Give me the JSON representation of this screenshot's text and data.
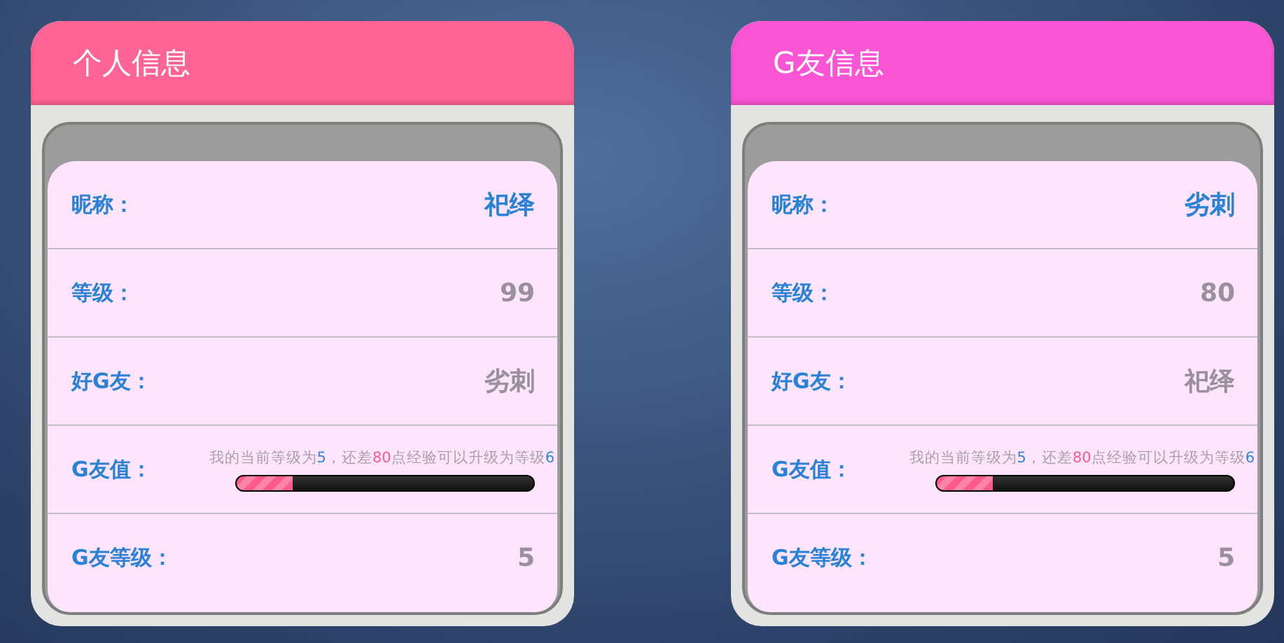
{
  "cards": [
    {
      "title": "个人信息",
      "color": "#fe6496",
      "rows": [
        {
          "kind": "highlight",
          "label": "昵称：",
          "value": "祀绎"
        },
        {
          "kind": "plain",
          "label": "等级：",
          "value": "99"
        },
        {
          "kind": "plain",
          "label": "好G友：",
          "value": "劣刺"
        },
        {
          "kind": "progress",
          "label": "G友值：",
          "hint": [
            {
              "kind": "plain",
              "text": "我的当前等级为"
            },
            {
              "kind": "number",
              "text": "5"
            },
            {
              "kind": "plain",
              "text": "，还差"
            },
            {
              "kind": "alert",
              "text": "80"
            },
            {
              "kind": "plain",
              "text": "点经验可以升级为等级"
            },
            {
              "kind": "number",
              "text": "6"
            }
          ],
          "level": 0.19
        },
        {
          "kind": "plain",
          "label": "G友等级：",
          "value": "5"
        }
      ]
    },
    {
      "title": "G友信息",
      "color": "#f955d5",
      "rows": [
        {
          "kind": "highlight",
          "label": "昵称：",
          "value": "劣刺"
        },
        {
          "kind": "plain",
          "label": "等级：",
          "value": "80"
        },
        {
          "kind": "plain",
          "label": "好G友：",
          "value": "祀绎"
        },
        {
          "kind": "progress",
          "label": "G友值：",
          "hint": [
            {
              "kind": "plain",
              "text": "我的当前等级为"
            },
            {
              "kind": "number",
              "text": "5"
            },
            {
              "kind": "plain",
              "text": "，还差"
            },
            {
              "kind": "alert",
              "text": "80"
            },
            {
              "kind": "plain",
              "text": "点经验可以升级为等级"
            },
            {
              "kind": "number",
              "text": "6"
            }
          ],
          "level": 0.19
        },
        {
          "kind": "plain",
          "label": "G友等级：",
          "value": "5"
        }
      ]
    }
  ]
}
